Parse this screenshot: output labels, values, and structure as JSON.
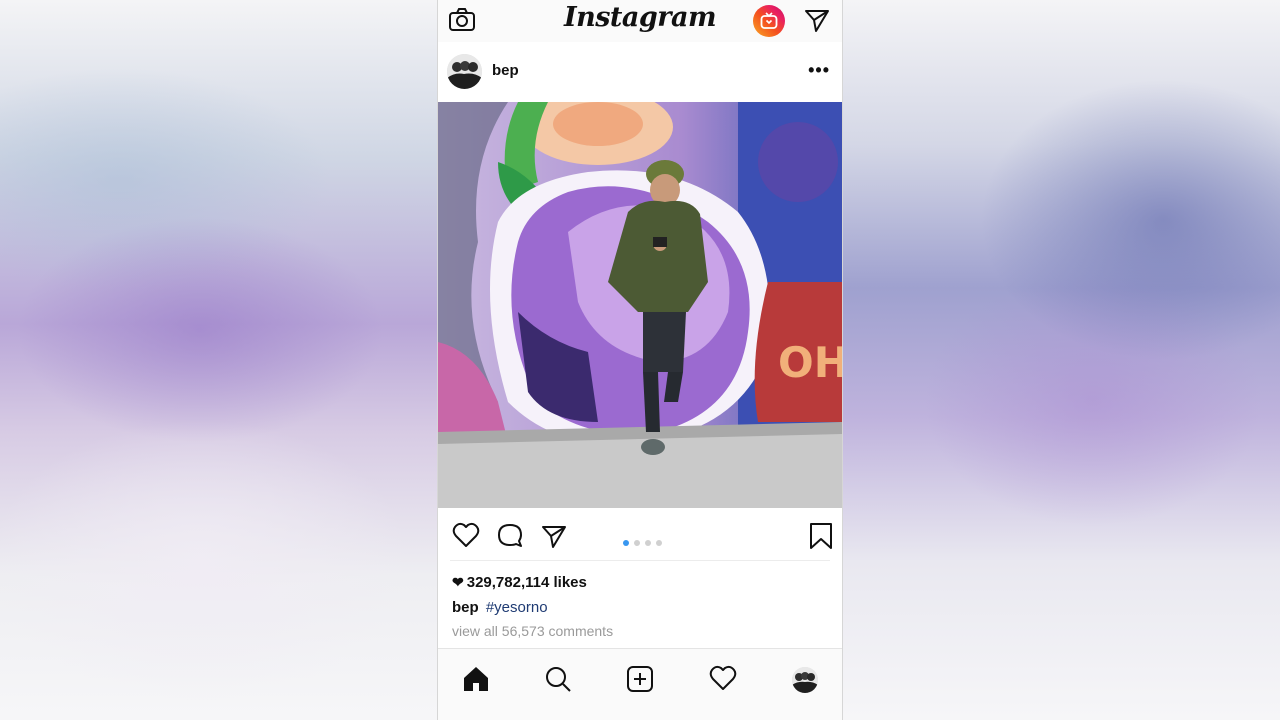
{
  "app": {
    "logo_text": "Instagram"
  },
  "post": {
    "username": "bep",
    "more_label": "•••",
    "likes_count": "329,782,114 likes",
    "caption_user": "bep",
    "caption_hashtag": "#yesorno",
    "comments_link": "view all 56,573 comments",
    "carousel": {
      "total": 4,
      "active_index": 0
    }
  },
  "icons": {
    "top": [
      "camera-icon",
      "igtv-icon",
      "direct-message-icon"
    ],
    "actions": [
      "like-heart-icon",
      "comment-icon",
      "share-icon",
      "bookmark-icon"
    ],
    "tabs": [
      "home-icon",
      "search-icon",
      "new-post-icon",
      "activity-heart-icon",
      "profile-avatar"
    ]
  },
  "colors": {
    "accent": "#3897f0",
    "hashtag": "#1f3b73",
    "muted": "#9a9a9a"
  }
}
